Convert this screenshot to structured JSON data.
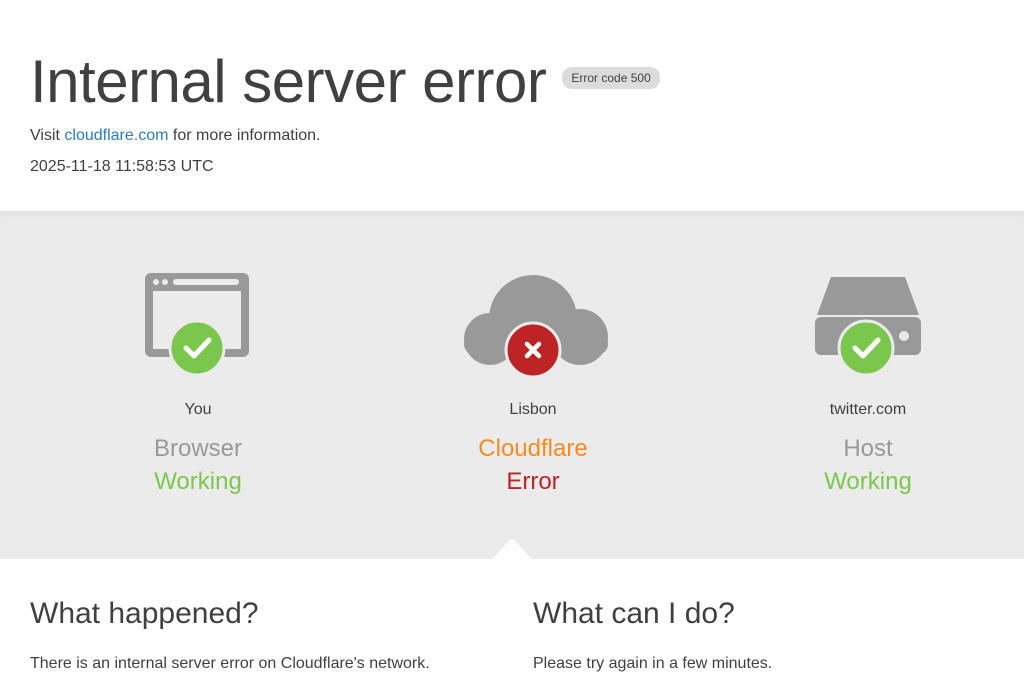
{
  "header": {
    "title": "Internal server error",
    "badge": "Error code 500",
    "visit_prefix": "Visit ",
    "visit_link": "cloudflare.com",
    "visit_suffix": " for more information.",
    "timestamp": "2025-11-18 11:58:53 UTC"
  },
  "status": {
    "browser": {
      "location": "You",
      "component": "Browser",
      "state": "Working",
      "icon": "browser-icon",
      "badge_icon": "check-icon"
    },
    "cloudflare": {
      "location": "Lisbon",
      "component": "Cloudflare",
      "state": "Error",
      "icon": "cloud-icon",
      "badge_icon": "x-icon"
    },
    "host": {
      "location": "twitter.com",
      "component": "Host",
      "state": "Working",
      "icon": "server-icon",
      "badge_icon": "check-icon"
    }
  },
  "colors": {
    "ok": "#7bc74d",
    "error": "#bd2426",
    "cloudflare_orange": "#f68b1f",
    "link": "#2f7bbf",
    "icon_gray": "#999999"
  },
  "info": {
    "what_happened_title": "What happened?",
    "what_happened_text": "There is an internal server error on Cloudflare's network.",
    "what_can_i_do_title": "What can I do?",
    "what_can_i_do_text": "Please try again in a few minutes."
  }
}
